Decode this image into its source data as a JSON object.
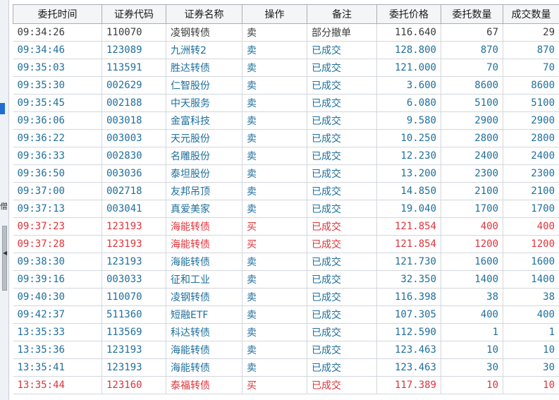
{
  "colors": {
    "sell": "#1f6f9c",
    "buy": "#e0333a",
    "partial": "#3b3b3b",
    "accent": "#1e6fd0"
  },
  "side_panel": {
    "glyph": "僧"
  },
  "table": {
    "headers": [
      "委托时间",
      "证券代码",
      "证券名称",
      "操作",
      "备注",
      "委托价格",
      "委托数量",
      "成交数量"
    ],
    "rows": [
      {
        "time": "09:34:26",
        "code": "110070",
        "name": "凌钢转债",
        "op": "卖",
        "status": "部分撤单",
        "price": "116.640",
        "qty": "67",
        "filled": "29",
        "kind": "partial"
      },
      {
        "time": "09:34:46",
        "code": "123089",
        "name": "九洲转2",
        "op": "卖",
        "status": "已成交",
        "price": "128.800",
        "qty": "870",
        "filled": "870",
        "kind": "sell"
      },
      {
        "time": "09:35:03",
        "code": "113591",
        "name": "胜达转债",
        "op": "卖",
        "status": "已成交",
        "price": "121.000",
        "qty": "70",
        "filled": "70",
        "kind": "sell"
      },
      {
        "time": "09:35:30",
        "code": "002629",
        "name": "仁智股份",
        "op": "卖",
        "status": "已成交",
        "price": "3.600",
        "qty": "8600",
        "filled": "8600",
        "kind": "sell"
      },
      {
        "time": "09:35:45",
        "code": "002188",
        "name": "中天服务",
        "op": "卖",
        "status": "已成交",
        "price": "6.080",
        "qty": "5100",
        "filled": "5100",
        "kind": "sell"
      },
      {
        "time": "09:36:06",
        "code": "003018",
        "name": "金富科技",
        "op": "卖",
        "status": "已成交",
        "price": "9.580",
        "qty": "2900",
        "filled": "2900",
        "kind": "sell"
      },
      {
        "time": "09:36:22",
        "code": "003003",
        "name": "天元股份",
        "op": "卖",
        "status": "已成交",
        "price": "10.250",
        "qty": "2800",
        "filled": "2800",
        "kind": "sell"
      },
      {
        "time": "09:36:33",
        "code": "002830",
        "name": "名雕股份",
        "op": "卖",
        "status": "已成交",
        "price": "12.230",
        "qty": "2400",
        "filled": "2400",
        "kind": "sell"
      },
      {
        "time": "09:36:50",
        "code": "003036",
        "name": "泰坦股份",
        "op": "卖",
        "status": "已成交",
        "price": "13.200",
        "qty": "2300",
        "filled": "2300",
        "kind": "sell"
      },
      {
        "time": "09:37:00",
        "code": "002718",
        "name": "友邦吊顶",
        "op": "卖",
        "status": "已成交",
        "price": "14.850",
        "qty": "2100",
        "filled": "2100",
        "kind": "sell"
      },
      {
        "time": "09:37:13",
        "code": "003041",
        "name": "真爱美家",
        "op": "卖",
        "status": "已成交",
        "price": "19.040",
        "qty": "1700",
        "filled": "1700",
        "kind": "sell"
      },
      {
        "time": "09:37:23",
        "code": "123193",
        "name": "海能转债",
        "op": "买",
        "status": "已成交",
        "price": "121.854",
        "qty": "400",
        "filled": "400",
        "kind": "buy"
      },
      {
        "time": "09:37:28",
        "code": "123193",
        "name": "海能转债",
        "op": "买",
        "status": "已成交",
        "price": "121.854",
        "qty": "1200",
        "filled": "1200",
        "kind": "buy"
      },
      {
        "time": "09:38:30",
        "code": "123193",
        "name": "海能转债",
        "op": "卖",
        "status": "已成交",
        "price": "121.730",
        "qty": "1600",
        "filled": "1600",
        "kind": "sell"
      },
      {
        "time": "09:39:16",
        "code": "003033",
        "name": "征和工业",
        "op": "卖",
        "status": "已成交",
        "price": "32.350",
        "qty": "1400",
        "filled": "1400",
        "kind": "sell"
      },
      {
        "time": "09:40:30",
        "code": "110070",
        "name": "凌钢转债",
        "op": "卖",
        "status": "已成交",
        "price": "116.398",
        "qty": "38",
        "filled": "38",
        "kind": "sell"
      },
      {
        "time": "09:42:37",
        "code": "511360",
        "name": "短融ETF",
        "op": "卖",
        "status": "已成交",
        "price": "107.305",
        "qty": "400",
        "filled": "400",
        "kind": "sell"
      },
      {
        "time": "13:35:33",
        "code": "113569",
        "name": "科达转债",
        "op": "卖",
        "status": "已成交",
        "price": "112.590",
        "qty": "1",
        "filled": "1",
        "kind": "sell"
      },
      {
        "time": "13:35:36",
        "code": "123193",
        "name": "海能转债",
        "op": "卖",
        "status": "已成交",
        "price": "123.463",
        "qty": "10",
        "filled": "10",
        "kind": "sell"
      },
      {
        "time": "13:35:41",
        "code": "123193",
        "name": "海能转债",
        "op": "卖",
        "status": "已成交",
        "price": "123.463",
        "qty": "30",
        "filled": "30",
        "kind": "sell"
      },
      {
        "time": "13:35:44",
        "code": "123160",
        "name": "泰福转债",
        "op": "买",
        "status": "已成交",
        "price": "117.389",
        "qty": "10",
        "filled": "10",
        "kind": "buy"
      }
    ]
  }
}
